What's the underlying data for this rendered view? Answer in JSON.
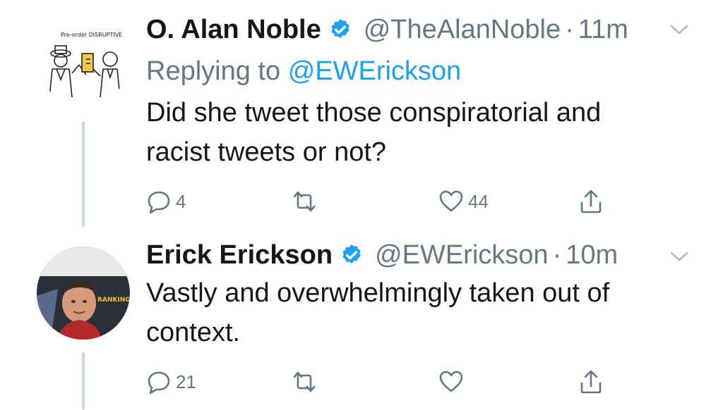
{
  "tweets": [
    {
      "display_name": "O. Alan Noble",
      "handle": "@TheAlanNoble",
      "separator": "·",
      "time": "11m",
      "replying_prefix": "Replying to",
      "replying_to": "@EWErickson",
      "text_line1": "Did she tweet those conspiratorial and",
      "text_line2": "racist tweets or not?",
      "replies": "4",
      "retweets": "",
      "likes": "44",
      "avatar_text": "Pre-order DISRUPTIVE WITNESS"
    },
    {
      "display_name": "Erick Erickson",
      "handle": "@EWErickson",
      "separator": "·",
      "time": "10m",
      "text_line1": "Vastly and overwhelmingly taken out of",
      "text_line2": "context.",
      "replies": "21",
      "retweets": "",
      "likes": "",
      "avatar_text": "RANKING THE MEN AND WOMEN WHO RUN"
    }
  ],
  "icons": {
    "verified": "verified-badge-icon",
    "reply": "reply-icon",
    "retweet": "retweet-icon",
    "like": "heart-icon",
    "share": "share-icon",
    "menu": "chevron-down-icon"
  },
  "colors": {
    "verified": "#1da1f2",
    "link": "#1da1f2",
    "muted": "#657786",
    "thread_line": "#ccd6dd"
  }
}
